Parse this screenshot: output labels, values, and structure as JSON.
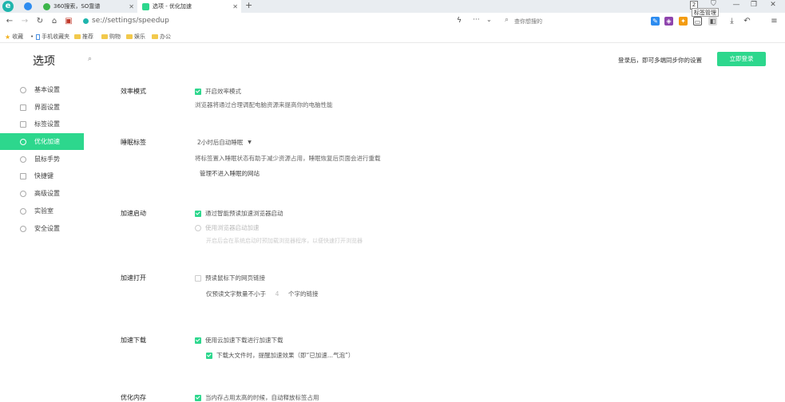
{
  "tabs": [
    {
      "label": "360搜索，SO靠谱",
      "active": false
    },
    {
      "label": "选项 - 优化加速",
      "active": true
    }
  ],
  "tab_close": "✕",
  "new_tab": "+",
  "tooltip": "标签管理",
  "tooltip_badge": "2",
  "window_controls": {
    "minimize": "—",
    "restore": "❐",
    "close": "✕"
  },
  "address": {
    "url": "se://settings/speedup",
    "search_placeholder": "查你想搜的"
  },
  "bookmarks": [
    {
      "label": "收藏",
      "type": "star"
    },
    {
      "label": "手机收藏夹",
      "type": "page"
    },
    {
      "label": "推荐",
      "type": "folder"
    },
    {
      "label": "购物",
      "type": "folder"
    },
    {
      "label": "娱乐",
      "type": "folder"
    },
    {
      "label": "办公",
      "type": "folder"
    }
  ],
  "page": {
    "title": "选项",
    "login_hint": "登录后，即可多端同步你的设置",
    "login_button": "立即登录"
  },
  "sidebar": [
    {
      "label": "基本设置"
    },
    {
      "label": "界面设置"
    },
    {
      "label": "标签设置"
    },
    {
      "label": "优化加速",
      "active": true
    },
    {
      "label": "鼠标手势"
    },
    {
      "label": "快捷键"
    },
    {
      "label": "高级设置"
    },
    {
      "label": "实验室"
    },
    {
      "label": "安全设置"
    }
  ],
  "sections": {
    "efficiency": {
      "title": "效率模式",
      "option": "开启效率模式",
      "desc": "浏览器将通过合理调配电脑资源来提高你的电脑性能"
    },
    "sleep": {
      "title": "睡眠标签",
      "select_value": "2小时后自动睡眠",
      "desc": "将标签置入睡眠状态有助于减少资源占用，睡眠恢复后页面会进行重载",
      "link": "管理不进入睡眠的网站"
    },
    "startup": {
      "title": "加速启动",
      "option1": "通过智能预读加速浏览器启动",
      "option2": "使用浏览器启动加速",
      "desc": "开启后会在系统启动时预加载浏览器程序，以便快速打开浏览器"
    },
    "open": {
      "title": "加速打开",
      "option": "预读鼠标下的网页链接",
      "sub_prefix": "仅预读文字数量不小于",
      "sub_value": "4",
      "sub_suffix": "个字的链接"
    },
    "download": {
      "title": "加速下载",
      "option1": "使用云加速下载进行加速下载",
      "option2": "下载大文件时，提醒加速效果（即“已加速...气泡”）"
    },
    "memory": {
      "title": "优化内存",
      "option": "当内存占用太高的时候，自动释放标签占用"
    }
  },
  "colors": {
    "accent": "#2dd78d",
    "tabbar": "#e9edf1",
    "brand_logo": "#1fb5ad"
  }
}
